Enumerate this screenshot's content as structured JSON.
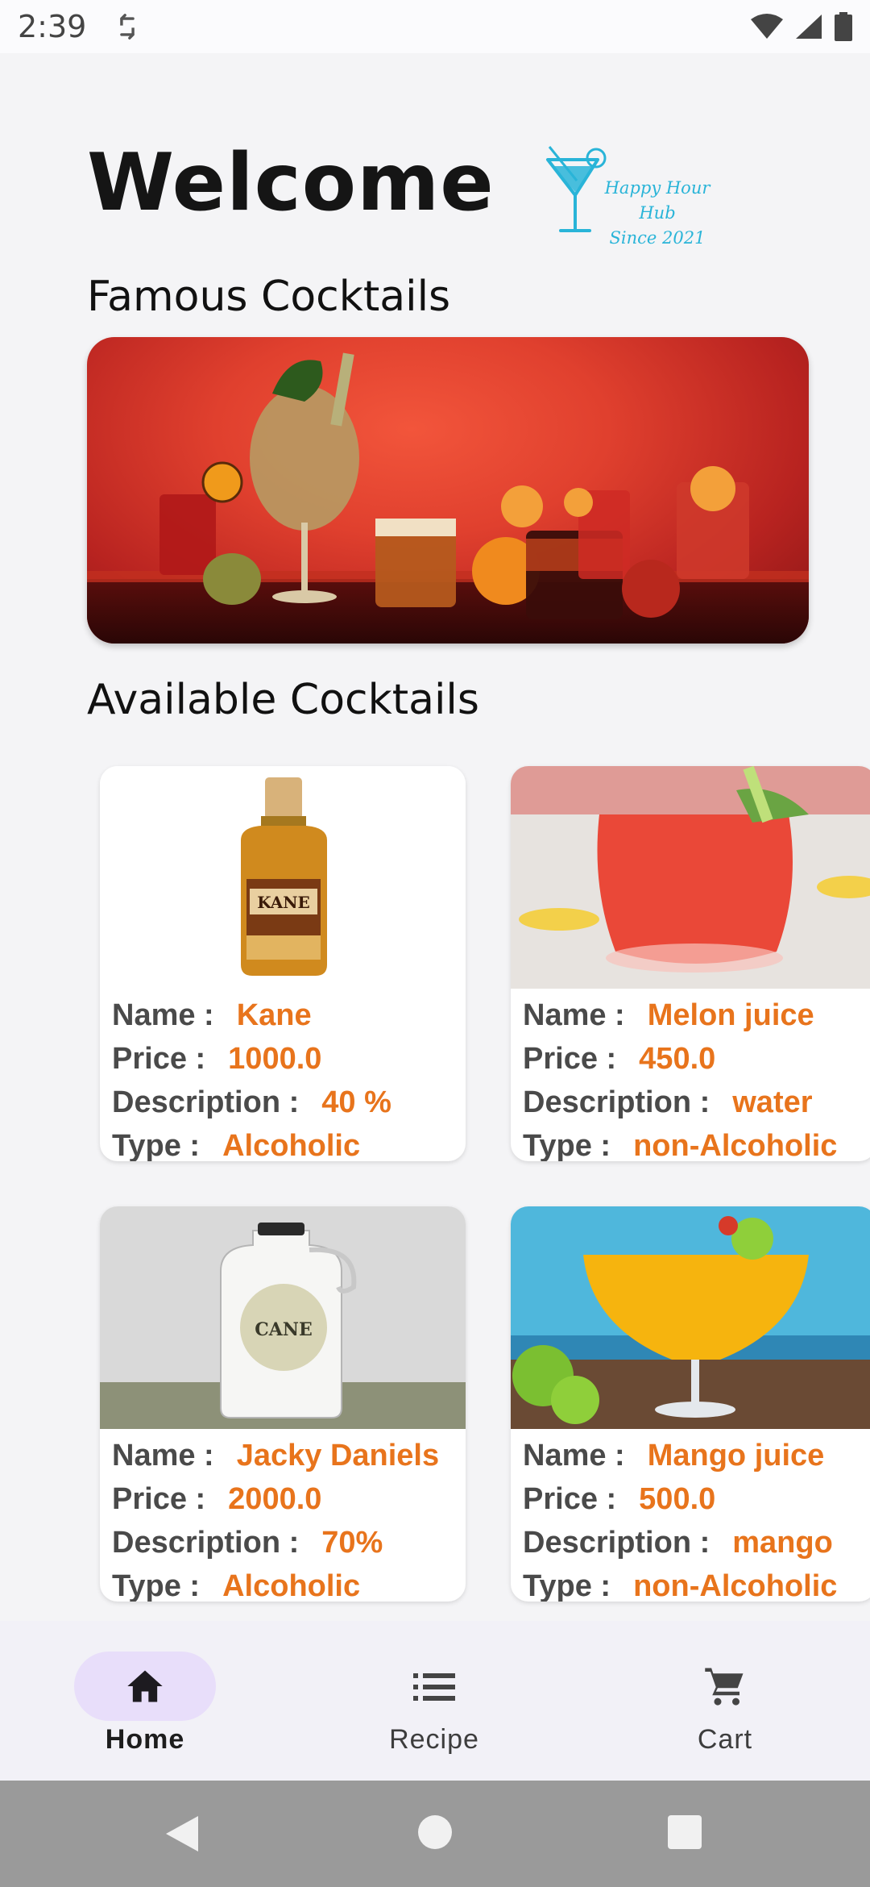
{
  "status_bar": {
    "time": "2:39"
  },
  "header": {
    "welcome": "Welcome",
    "logo": {
      "line1": "Happy Hour Hub",
      "line2": "Since 2021"
    }
  },
  "sections": {
    "famous": "Famous Cocktails",
    "available": "Available Cocktails"
  },
  "labels": {
    "name": "Name :",
    "price": "Price :",
    "description": "Description :",
    "type": "Type :"
  },
  "cocktails": [
    {
      "name": "Kane",
      "price": "1000.0",
      "description": "40 %",
      "type": "Alcoholic"
    },
    {
      "name": "Melon juice",
      "price": "450.0",
      "description": "water",
      "type": "non-Alcoholic"
    },
    {
      "name": "Jacky Daniels",
      "price": "2000.0",
      "description": "70%",
      "type": "Alcoholic"
    },
    {
      "name": "Mango juice",
      "price": "500.0",
      "description": "mango",
      "type": "non-Alcoholic"
    }
  ],
  "bottom_nav": [
    {
      "label": "Home",
      "icon": "home-icon",
      "selected": true
    },
    {
      "label": "Recipe",
      "icon": "list-icon",
      "selected": false
    },
    {
      "label": "Cart",
      "icon": "cart-icon",
      "selected": false
    }
  ],
  "colors": {
    "accent": "#e8741c",
    "nav_selected": "#e8defa",
    "logo": "#29b4d8"
  }
}
